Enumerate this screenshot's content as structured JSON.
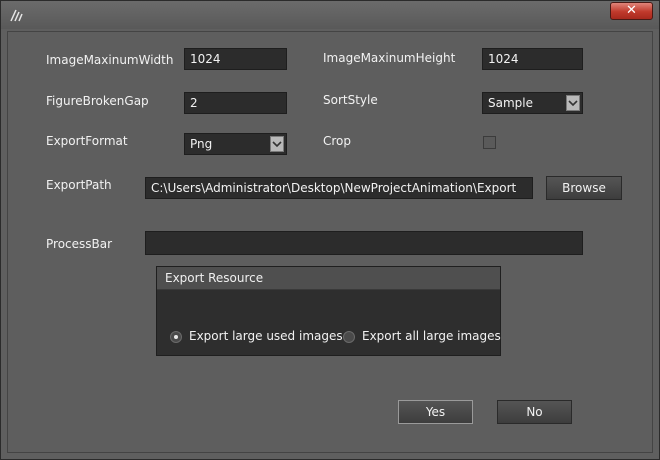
{
  "window": {
    "close_label": "✕"
  },
  "fields": {
    "image_max_width": {
      "label": "ImageMaxinumWidth",
      "value": "1024"
    },
    "image_max_height": {
      "label": "ImageMaxinumHeight",
      "value": "1024"
    },
    "figure_broken_gap": {
      "label": "FigureBrokenGap",
      "value": "2"
    },
    "sort_style": {
      "label": "SortStyle",
      "value": "Sample"
    },
    "export_format": {
      "label": "ExportFormat",
      "value": "Png"
    },
    "crop": {
      "label": "Crop",
      "checked": false
    },
    "export_path": {
      "label": "ExportPath",
      "value": "C:\\Users\\Administrator\\Desktop\\NewProjectAnimation\\Export"
    },
    "process_bar": {
      "label": "ProcessBar",
      "progress": 0
    }
  },
  "browse_label": "Browse",
  "export_resource": {
    "title": "Export Resource",
    "options": [
      {
        "label": "Export large used images",
        "selected": true
      },
      {
        "label": "Export all large images",
        "selected": false
      }
    ]
  },
  "buttons": {
    "yes": "Yes",
    "no": "No"
  },
  "colors": {
    "background": "#5e5e5e",
    "field": "#2c2c2c",
    "close": "#c0392b"
  }
}
